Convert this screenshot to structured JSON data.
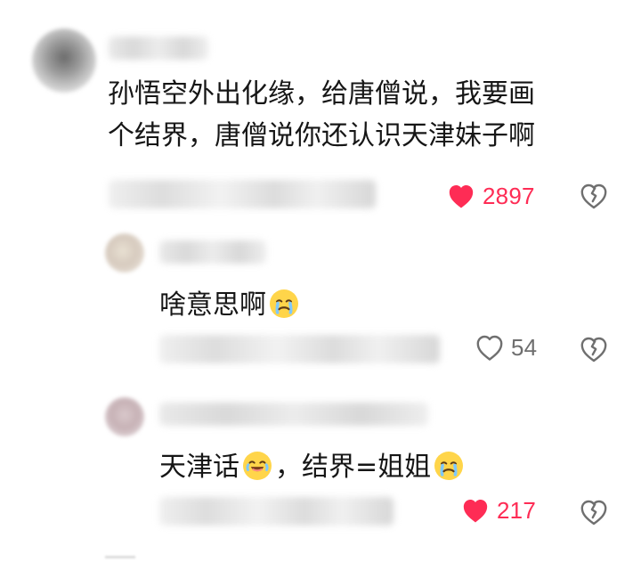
{
  "main_comment": {
    "text": "孙悟空外出化缘，给唐僧说，我要画\n个结界，唐僧说你还认识天津妹子啊",
    "like_count": "2897",
    "liked": true,
    "like_icon": "heart-filled-icon",
    "dislike_icon": "broken-heart-icon",
    "hidden_fields": [
      "author-name",
      "timestamp-location",
      "reply-button-label"
    ]
  },
  "replies": [
    {
      "text": "啥意思啊",
      "trailing_emoji": "crying-face-emoji",
      "like_count": "54",
      "liked": false,
      "like_icon": "heart-outline-icon",
      "dislike_icon": "broken-heart-icon"
    },
    {
      "segments": [
        "天津话",
        "，结界=姐姐"
      ],
      "emojis": [
        "laughing-tears-emoji",
        "crying-face-emoji"
      ],
      "like_count": "217",
      "liked": true,
      "like_icon": "heart-filled-icon",
      "dislike_icon": "broken-heart-icon"
    }
  ],
  "colors": {
    "text": "#161616",
    "secondary_text": "#6f6f6f",
    "accent": "#fe2c55",
    "background": "#ffffff"
  }
}
